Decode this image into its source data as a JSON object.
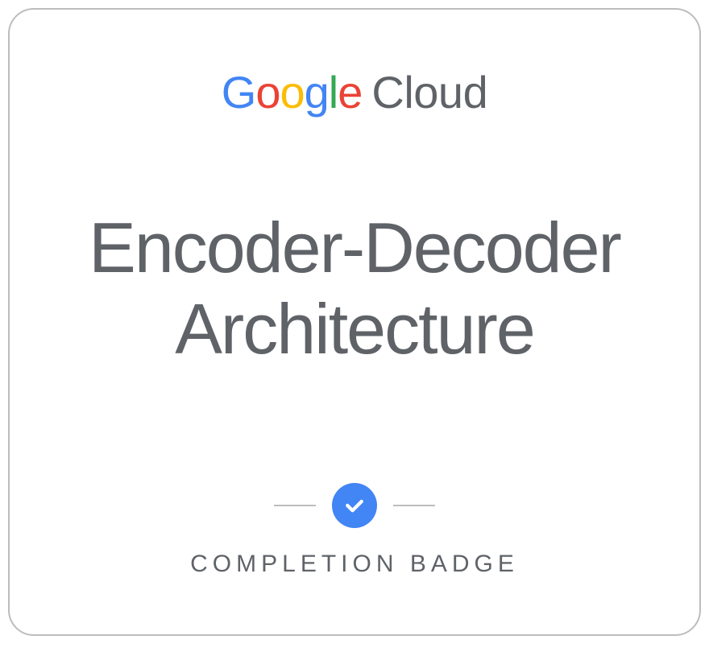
{
  "brand": {
    "name": "Google",
    "product": "Cloud"
  },
  "course": {
    "title": "Encoder-Decoder Architecture"
  },
  "badge": {
    "label": "COMPLETION BADGE"
  },
  "colors": {
    "blue": "#4285F4",
    "red": "#EA4335",
    "yellow": "#FBBC05",
    "green": "#34A853",
    "gray": "#5f6368"
  }
}
